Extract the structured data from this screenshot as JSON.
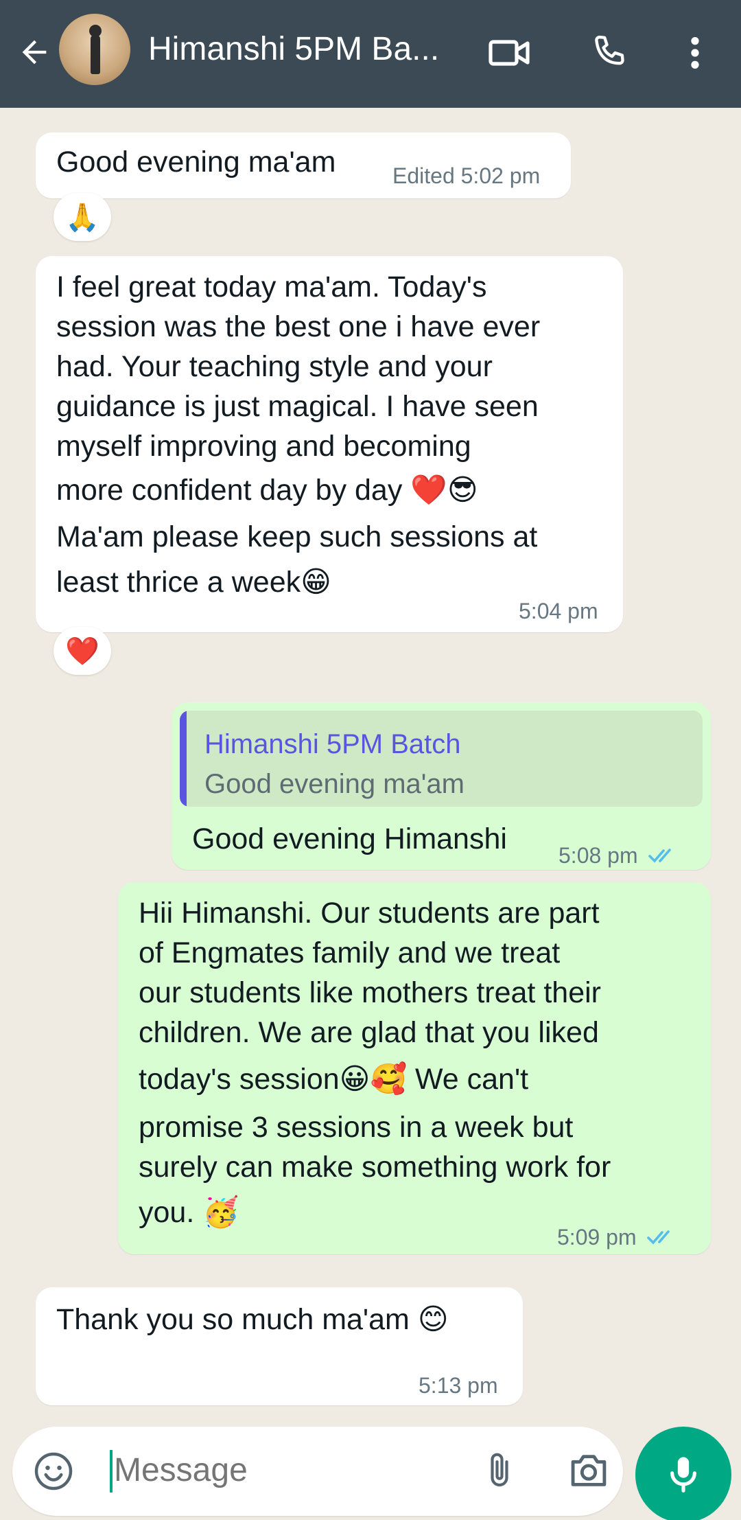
{
  "header": {
    "title": "Himanshi 5PM Ba...",
    "icons": [
      "back-arrow-icon",
      "video-call-icon",
      "voice-call-icon",
      "more-options-icon"
    ]
  },
  "messages": [
    {
      "dir": "in",
      "text": "Good evening ma'am",
      "meta": "Edited",
      "time": "5:02 pm",
      "reaction": "🙏"
    },
    {
      "dir": "in",
      "lines": [
        "I feel great today ma'am. Today's",
        "session was the best one i have ever",
        "had. Your teaching style and your",
        "guidance is just magical. I have seen",
        "myself improving and becoming",
        "more confident day by day ❤️😎",
        "Ma'am please keep such sessions at",
        "least thrice a week😁"
      ],
      "time": "5:04 pm",
      "reaction": "❤️"
    },
    {
      "dir": "out",
      "quote_name": "Himanshi 5PM Batch",
      "quote_text": "Good evening ma'am",
      "text": "Good evening Himanshi",
      "time": "5:08 pm"
    },
    {
      "dir": "out",
      "lines": [
        "Hii Himanshi. Our students are part",
        "of Engmates family and we treat",
        "our students like mothers treat their",
        "children. We are glad that you liked",
        "today's session😀🥰 We can't",
        "promise 3 sessions in a week but",
        "surely can make something work for",
        "you. 🥳"
      ],
      "time": "5:09 pm"
    },
    {
      "dir": "in",
      "text": "Thank you so much ma'am 😊",
      "time": "5:13 pm"
    }
  ],
  "composer": {
    "placeholder": "Message",
    "icons": [
      "emoji-icon",
      "attach-icon",
      "camera-icon",
      "mic-icon"
    ]
  },
  "colors": {
    "header_bg": "#3b4a54",
    "chat_bg": "#efeae2",
    "outgoing_bubble": "#d9fdd3",
    "incoming_bubble": "#ffffff",
    "accent": "#00a884",
    "read_ticks": "#53bdeb",
    "quote_name": "#5b54e0"
  }
}
